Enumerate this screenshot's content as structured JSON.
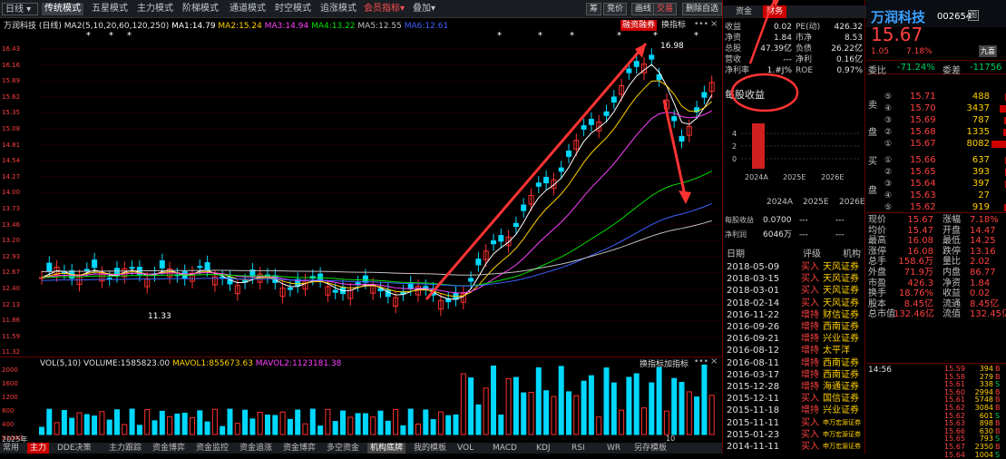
{
  "toolbar": {
    "period": "日线",
    "tabs": [
      "传统模式",
      "五星模式",
      "主力模式",
      "阶梯模式",
      "通道模式",
      "时空模式",
      "追涨模式"
    ],
    "member": "会员指标",
    "overlay": "叠加",
    "right": [
      "筹",
      "竞价",
      "画线",
      "交易",
      "删除自选"
    ]
  },
  "chart": {
    "title": "万润科技",
    "period_label": "(日线)",
    "ma_label": "MA2(5,10,20,60,120,250)",
    "ma1": "MA1:14.79",
    "ma2": "MA2:15.24",
    "ma3": "MA3:14.94",
    "ma4": "MA4:13.22",
    "ma5": "MA5:12.55",
    "ma6": "MA6:12.61",
    "badge1": "融资融券",
    "badge2": "换指标",
    "high_label": "16.98",
    "low_label": "11.33",
    "y_ticks": [
      "16.43",
      "16.16",
      "15.89",
      "15.62",
      "15.35",
      "15.08",
      "14.81",
      "14.54",
      "14.27",
      "14.00",
      "13.73",
      "13.46",
      "13.20",
      "12.93",
      "12.67",
      "12.40",
      "12.13",
      "11.86",
      "11.59",
      "11.32"
    ]
  },
  "volume": {
    "title": "VOL(5,10)",
    "volume": "VOLUME:1585823.00",
    "mavol1": "MAVOL1:855673.63",
    "mavol2": "MAVOL2:1123181.38",
    "buttons": [
      "换指标",
      "加指标"
    ],
    "y_ticks": [
      "2000",
      "1600",
      "1200",
      "800",
      "400",
      "X1000"
    ],
    "year": "2025年",
    "month": "10"
  },
  "bottom_tabs": [
    "常用",
    "主力",
    "DDE决策",
    "主力跟踪",
    "资金博弈",
    "资金监控",
    "资金追涨",
    "资金博弈",
    "多空资金",
    "机构底牌",
    "我的模板",
    "VOL",
    "MACD",
    "KDJ",
    "RSI",
    "WR",
    "另存模板"
  ],
  "mid": {
    "tabs": [
      "资金",
      "财务"
    ],
    "fin": [
      [
        "收益",
        "0.02",
        "PE(动)",
        "426.32"
      ],
      [
        "净资",
        "1.84",
        "市净",
        "8.53"
      ],
      [
        "总股",
        "47.39亿",
        "负债",
        "26.22亿"
      ],
      [
        "营收",
        "---",
        "净利",
        "0.16亿"
      ],
      [
        "净利率",
        "1.#J%",
        "ROE",
        "0.97%"
      ]
    ],
    "eps_title": "每股收益",
    "eps_ticks": [
      "4",
      "2",
      "0"
    ],
    "eps_years": [
      "2024A",
      "2025E",
      "2026E"
    ],
    "forecast_head": [
      "2024A",
      "2025E",
      "2026E"
    ],
    "forecast": [
      [
        "每股收益",
        "0.0700",
        "---",
        "---"
      ],
      [
        "净利润",
        "6046万",
        "---",
        "---"
      ]
    ],
    "rating_head": [
      "日期",
      "评级",
      "机构"
    ],
    "ratings": [
      [
        "2018-05-09",
        "买入",
        "天风证券"
      ],
      [
        "2018-03-15",
        "买入",
        "天风证券"
      ],
      [
        "2018-03-01",
        "买入",
        "天风证券"
      ],
      [
        "2018-02-14",
        "买入",
        "天风证券"
      ],
      [
        "2016-11-22",
        "增持",
        "财信证券"
      ],
      [
        "2016-09-26",
        "增持",
        "西南证券"
      ],
      [
        "2016-09-21",
        "增持",
        "兴业证券"
      ],
      [
        "2016-08-12",
        "增持",
        "太平洋"
      ],
      [
        "2016-08-11",
        "增持",
        "西南证券"
      ],
      [
        "2016-03-17",
        "增持",
        "西南证券"
      ],
      [
        "2015-12-28",
        "增持",
        "海通证券"
      ],
      [
        "2015-12-11",
        "买入",
        "国信证券"
      ],
      [
        "2015-11-18",
        "增持",
        "兴业证券"
      ],
      [
        "2015-11-11",
        "买入",
        "申万宏源证券"
      ],
      [
        "2015-01-23",
        "买入",
        "申万宏源证券"
      ],
      [
        "2014-11-11",
        "买入",
        "申万宏源证券"
      ]
    ]
  },
  "right": {
    "name": "万润科技",
    "code": "002654",
    "price": "15.67",
    "change": "1.05",
    "pct": "7.18%",
    "tag": "九喜",
    "weibi_label": "委比",
    "weibi": "-71.24%",
    "weicha_label": "委差",
    "weicha": "-11756",
    "sell_label": [
      "卖",
      "盘"
    ],
    "buy_label": [
      "买",
      "盘"
    ],
    "sells": [
      [
        "⑤",
        "15.71",
        "488"
      ],
      [
        "④",
        "15.70",
        "3437"
      ],
      [
        "③",
        "15.69",
        "787"
      ],
      [
        "②",
        "15.68",
        "1335"
      ],
      [
        "①",
        "15.67",
        "8082"
      ]
    ],
    "buys": [
      [
        "①",
        "15.66",
        "637"
      ],
      [
        "②",
        "15.65",
        "393"
      ],
      [
        "③",
        "15.64",
        "397"
      ],
      [
        "④",
        "15.63",
        "27"
      ],
      [
        "⑤",
        "15.62",
        "919"
      ]
    ],
    "stats": [
      [
        "现价",
        "15.67",
        "涨幅",
        "7.18%"
      ],
      [
        "均价",
        "15.47",
        "开盘",
        "14.47"
      ],
      [
        "最高",
        "16.08",
        "最低",
        "14.25"
      ],
      [
        "涨停",
        "16.08",
        "跌停",
        "13.16"
      ],
      [
        "总手",
        "158.6万",
        "量比",
        "2.02"
      ],
      [
        "外盘",
        "71.9万",
        "内盘",
        "86.77"
      ],
      [
        "市盈",
        "426.3",
        "净资",
        "1.84"
      ],
      [
        "换手",
        "18.76%",
        "收益",
        "0.02"
      ],
      [
        "股本",
        "8.45亿",
        "流通",
        "8.45亿"
      ],
      [
        "总市值",
        "132.46亿",
        "流值",
        "132.45亿"
      ]
    ],
    "time": "14:56",
    "ticks": [
      [
        "15.59",
        "394",
        "B"
      ],
      [
        "15.58",
        "279",
        "B"
      ],
      [
        "15.61",
        "338",
        "S"
      ],
      [
        "15.60",
        "2994",
        "B"
      ],
      [
        "15.61",
        "5748",
        "B"
      ],
      [
        "15.62",
        "3084",
        "B"
      ],
      [
        "15.62",
        "601",
        "S"
      ],
      [
        "15.63",
        "898",
        "B"
      ],
      [
        "15.66",
        "630",
        "B"
      ],
      [
        "15.65",
        "793",
        "S"
      ],
      [
        "15.67",
        "2350",
        "B"
      ],
      [
        "15.64",
        "1004",
        "S"
      ]
    ]
  },
  "colors": {
    "up": "#ff4040",
    "down": "#00d0ff",
    "annot": "#ff3333"
  }
}
